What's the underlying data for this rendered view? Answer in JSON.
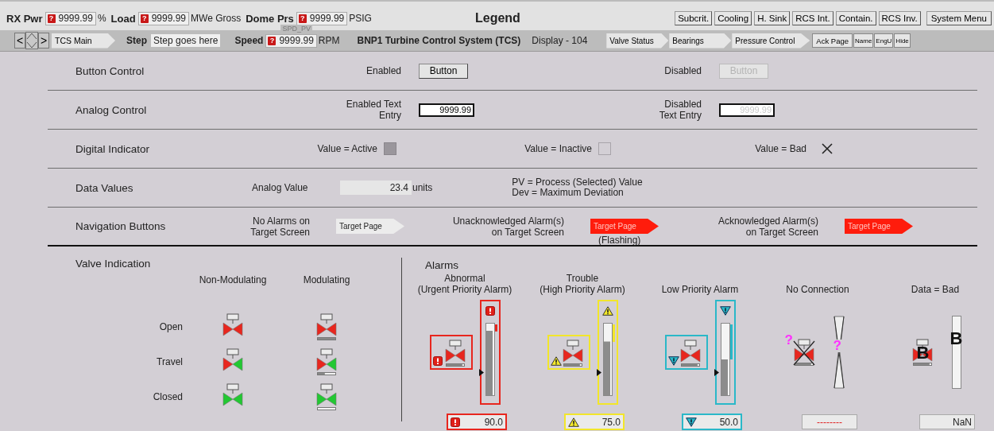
{
  "header": {
    "readouts": [
      {
        "label": "RX Pwr",
        "flag": "?",
        "value": "9999.99",
        "unit": "%"
      },
      {
        "label": "Load",
        "flag": "?",
        "value": "9999.99",
        "unit": "MWe Gross"
      },
      {
        "label": "Dome Prs",
        "flag": "?",
        "value": "9999.99",
        "unit": "PSIG"
      }
    ],
    "title": "Legend",
    "menu_buttons": [
      "Subcrit.",
      "Cooling",
      "H. Sink",
      "RCS Int.",
      "Contain.",
      "RCS Inv.",
      "System Menu"
    ]
  },
  "toolbar": {
    "back": "<",
    "forward": ">",
    "home_tab": "TCS Main",
    "step_label": "Step",
    "step_value": "Step goes here",
    "speed": {
      "tag": "SPD_PV",
      "label": "Speed",
      "flag": "?",
      "value": "9999.99",
      "unit": "RPM"
    },
    "system_title": "BNP1 Turbine Control System (TCS)",
    "display": "Display - 104",
    "page_tabs": [
      "Valve Status",
      "Bearings",
      "Pressure Control"
    ],
    "small_buttons": [
      "Ack Page",
      "Name",
      "EngU",
      "Hide"
    ]
  },
  "rows": [
    {
      "kind": "buttons",
      "label": "Button Control",
      "items": [
        {
          "caption": "Enabled",
          "button": "Button",
          "disabled": false
        },
        {
          "caption": "Disabled",
          "button": "Button",
          "disabled": true
        }
      ]
    },
    {
      "kind": "entries",
      "label": "Analog Control",
      "items": [
        {
          "caption": "Enabled Text\nEntry",
          "value": "9999.99",
          "disabled": false
        },
        {
          "caption": "Disabled\nText Entry",
          "value": "9999.99",
          "disabled": true
        }
      ]
    },
    {
      "kind": "indicators",
      "label": "Digital Indicator",
      "items": [
        {
          "caption": "Value =  Active",
          "kind": "active"
        },
        {
          "caption": "Value = Inactive",
          "kind": "inactive"
        },
        {
          "caption": "Value = Bad",
          "kind": "bad"
        }
      ]
    },
    {
      "kind": "data",
      "label": "Data Values",
      "caption": "Analog Value",
      "value": "23.4",
      "unit": "units",
      "notes": [
        "PV = Process (Selected) Value",
        "Dev = Maximum Deviation"
      ]
    },
    {
      "kind": "nav",
      "label": "Navigation Buttons",
      "items": [
        {
          "caption": "No Alarms on\nTarget Screen",
          "button": "Target Page",
          "kind": "none"
        },
        {
          "caption": "Unacknowledged Alarm(s)\non Target Screen",
          "button": "Target Page",
          "kind": "unacknowledged",
          "note": "(Flashing)"
        },
        {
          "caption": "Acknowledged Alarm(s)\non Target Screen",
          "button": "Target Page",
          "kind": "acknowledged"
        }
      ]
    }
  ],
  "valves": {
    "title": "Valve Indication",
    "columns": [
      {
        "label": "Non-Modulating",
        "kind": "non_modulating"
      },
      {
        "label": "Modulating",
        "kind": "modulating"
      }
    ],
    "rows": [
      {
        "label": "Open",
        "kind": "open"
      },
      {
        "label": "Travel",
        "kind": "travel"
      },
      {
        "label": "Closed",
        "kind": "closed"
      }
    ]
  },
  "alarms": {
    "title": "Alarms",
    "items": [
      {
        "kind": "urgent",
        "caption": "Abnormal\n(Urgent Priority Alarm)",
        "level": 0.9,
        "value": "90.0"
      },
      {
        "kind": "high",
        "caption": "Trouble\n(High Priority Alarm)",
        "level": 0.75,
        "value": "75.0"
      },
      {
        "kind": "low",
        "caption": "Low Priority Alarm",
        "level": 0.5,
        "value": "50.0"
      },
      {
        "kind": "no_connection",
        "caption": "No Connection",
        "valve_mark": "?",
        "bar_mark": "?",
        "value": "--------"
      },
      {
        "kind": "bad",
        "caption": "Data = Bad",
        "valve_mark": "B",
        "bar_mark": "B",
        "value": "NaN"
      }
    ]
  }
}
